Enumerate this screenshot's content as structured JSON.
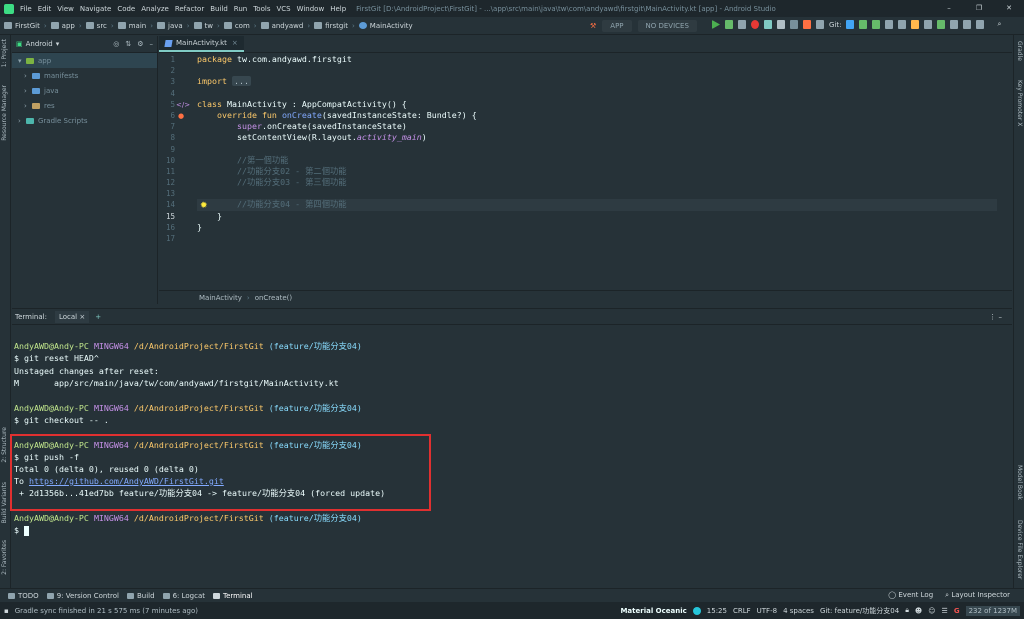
{
  "menubar": {
    "items": [
      "File",
      "Edit",
      "View",
      "Navigate",
      "Code",
      "Analyze",
      "Refactor",
      "Build",
      "Run",
      "Tools",
      "VCS",
      "Window",
      "Help"
    ],
    "title": "FirstGit [D:\\AndroidProject\\FirstGit] - ...\\app\\src\\main\\java\\tw\\com\\andyawd\\firstgit\\MainActivity.kt [app] - Android Studio"
  },
  "breadcrumbs": [
    "FirstGit",
    "app",
    "src",
    "main",
    "java",
    "tw",
    "com",
    "andyawd",
    "firstgit",
    "MainActivity"
  ],
  "toolbar": {
    "run_config": "APP",
    "devices": "NO DEVICES",
    "git_label": "Git:"
  },
  "project_panel": {
    "view": "Android",
    "tree": [
      {
        "label": "app",
        "selected": true,
        "indent": 0
      },
      {
        "label": "manifests",
        "indent": 1
      },
      {
        "label": "java",
        "indent": 1
      },
      {
        "label": "res",
        "indent": 1
      },
      {
        "label": "Gradle Scripts",
        "indent": 0
      }
    ]
  },
  "editor": {
    "tab": "MainActivity.kt",
    "current_line": 15,
    "breadcrumb": [
      "MainActivity",
      "onCreate()"
    ]
  },
  "left_tool_tabs": [
    "1: Project",
    "Resource Manager",
    "2: Structure",
    "Build Variants",
    "2: Favorites"
  ],
  "right_tool_tabs": [
    "Gradle",
    "Key Promoter X",
    "Model Book",
    "Device File Explorer"
  ],
  "terminal": {
    "label": "Terminal:",
    "tab": "Local",
    "prompt": {
      "user": "AndyAWD@Andy-PC",
      "shell": "MINGW64",
      "dir": "/d/AndroidProject/FirstGit",
      "branch": "(feature/功能分支04)"
    },
    "commands": {
      "reset": "$ git reset HEAD^",
      "unstaged": "Unstaged changes after reset:",
      "modified": "M       app/src/main/java/tw/com/andyawd/firstgit/MainActivity.kt",
      "checkout": "$ git checkout -- .",
      "push": "$ git push -f",
      "total": "Total 0 (delta 0), reused 0 (delta 0)",
      "to_prefix": "To ",
      "url": "https://github.com/AndyAWD/FirstGit.git",
      "update": " + 2d1356b...41ed7bb feature/功能分支04 -> feature/功能分支04 (forced update)",
      "final": "$ "
    }
  },
  "bottom_tabs": [
    "TODO",
    "9: Version Control",
    "Build",
    "6: Logcat",
    "Terminal"
  ],
  "bottom_right_tabs": [
    "Event Log",
    "Layout Inspector"
  ],
  "status": {
    "message": "Gradle sync finished in 21 s 575 ms (7 minutes ago)",
    "theme": "Material Oceanic",
    "time": "15:25",
    "line_sep": "CRLF",
    "encoding": "UTF-8",
    "indent": "4 spaces",
    "git": "Git: feature/功能分支04",
    "memory": "232 of 1237M"
  }
}
